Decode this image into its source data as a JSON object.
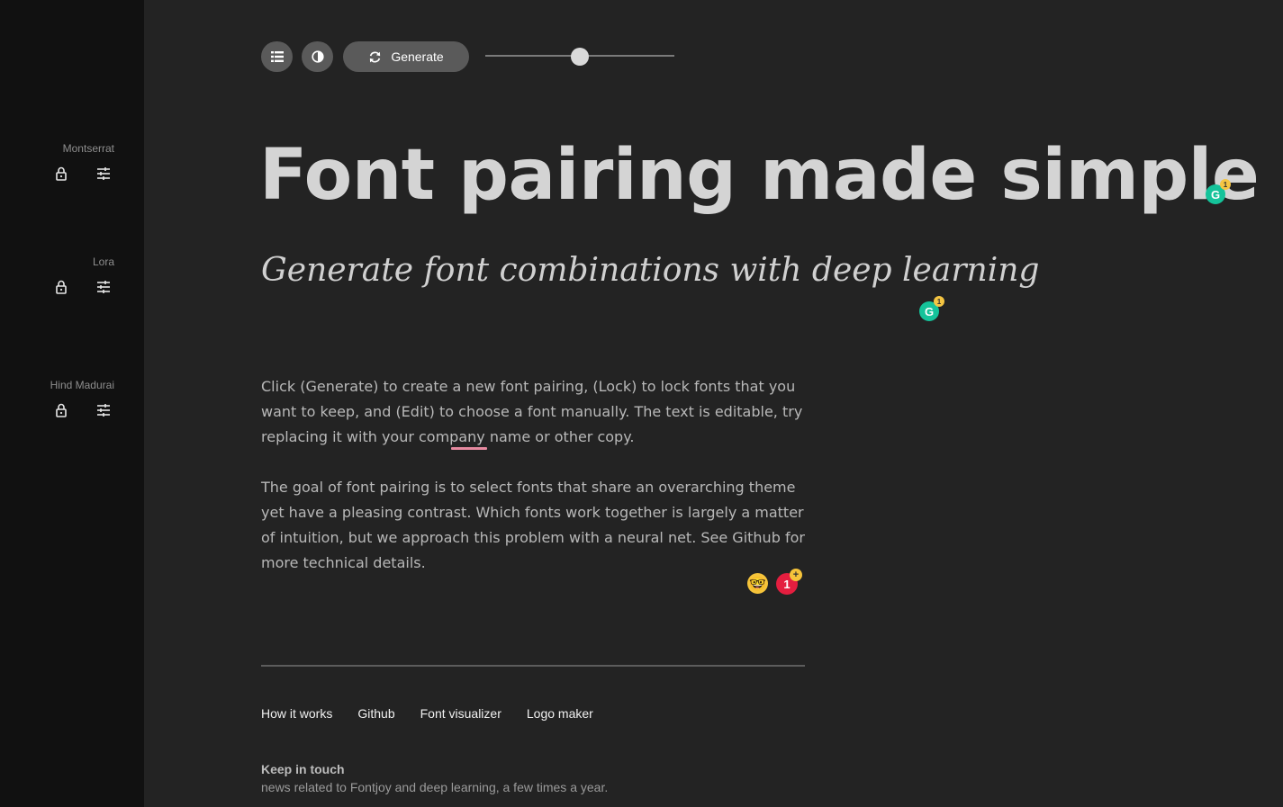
{
  "sidebar": {
    "fonts": [
      {
        "name": "Montserrat",
        "lock_icon": "lock-icon",
        "edit_icon": "tune-icon"
      },
      {
        "name": "Lora",
        "lock_icon": "lock-icon",
        "edit_icon": "tune-icon"
      },
      {
        "name": "Hind Madurai",
        "lock_icon": "lock-icon",
        "edit_icon": "tune-icon"
      }
    ]
  },
  "toolbar": {
    "list_icon": "list-icon",
    "contrast_icon": "contrast-icon",
    "generate_icon": "refresh-icon",
    "generate_label": "Generate",
    "slider_value": 0.5
  },
  "main": {
    "headline": "Font pairing made simple",
    "subhead": "Generate font combinations with deep learning",
    "para1_a": "Click (Generate) to create a new font pairing, (Lock) to lock fonts that you want to keep, and (Edit) to choose a font manually. The text is editable, try replacing it with your company name or ",
    "para1_misspelled": "other",
    "para1_b": " copy.",
    "para2": "The goal of font pairing is to select fonts that share an overarching theme yet have a pleasing contrast. Which fonts work together is largely a matter of intuition, but we approach this problem with a neural net. See Github for more technical details."
  },
  "overlays": {
    "grammarly_letter": "G",
    "grammarly_count": "1",
    "emoji": "🤓",
    "notification_count": "1",
    "notification_plus": "+"
  },
  "footer": {
    "links": [
      "How it works",
      "Github",
      "Font visualizer",
      "Logo maker"
    ],
    "keep_title": "Keep in touch",
    "keep_sub": "news related to Fontjoy and deep learning, a few times a year."
  },
  "colors": {
    "page_bg": "#232323",
    "sidebar_bg": "#111111",
    "button_bg": "#5a5a5a",
    "grammarly_green": "#15c39a",
    "spell_underline": "#e68aa0"
  }
}
